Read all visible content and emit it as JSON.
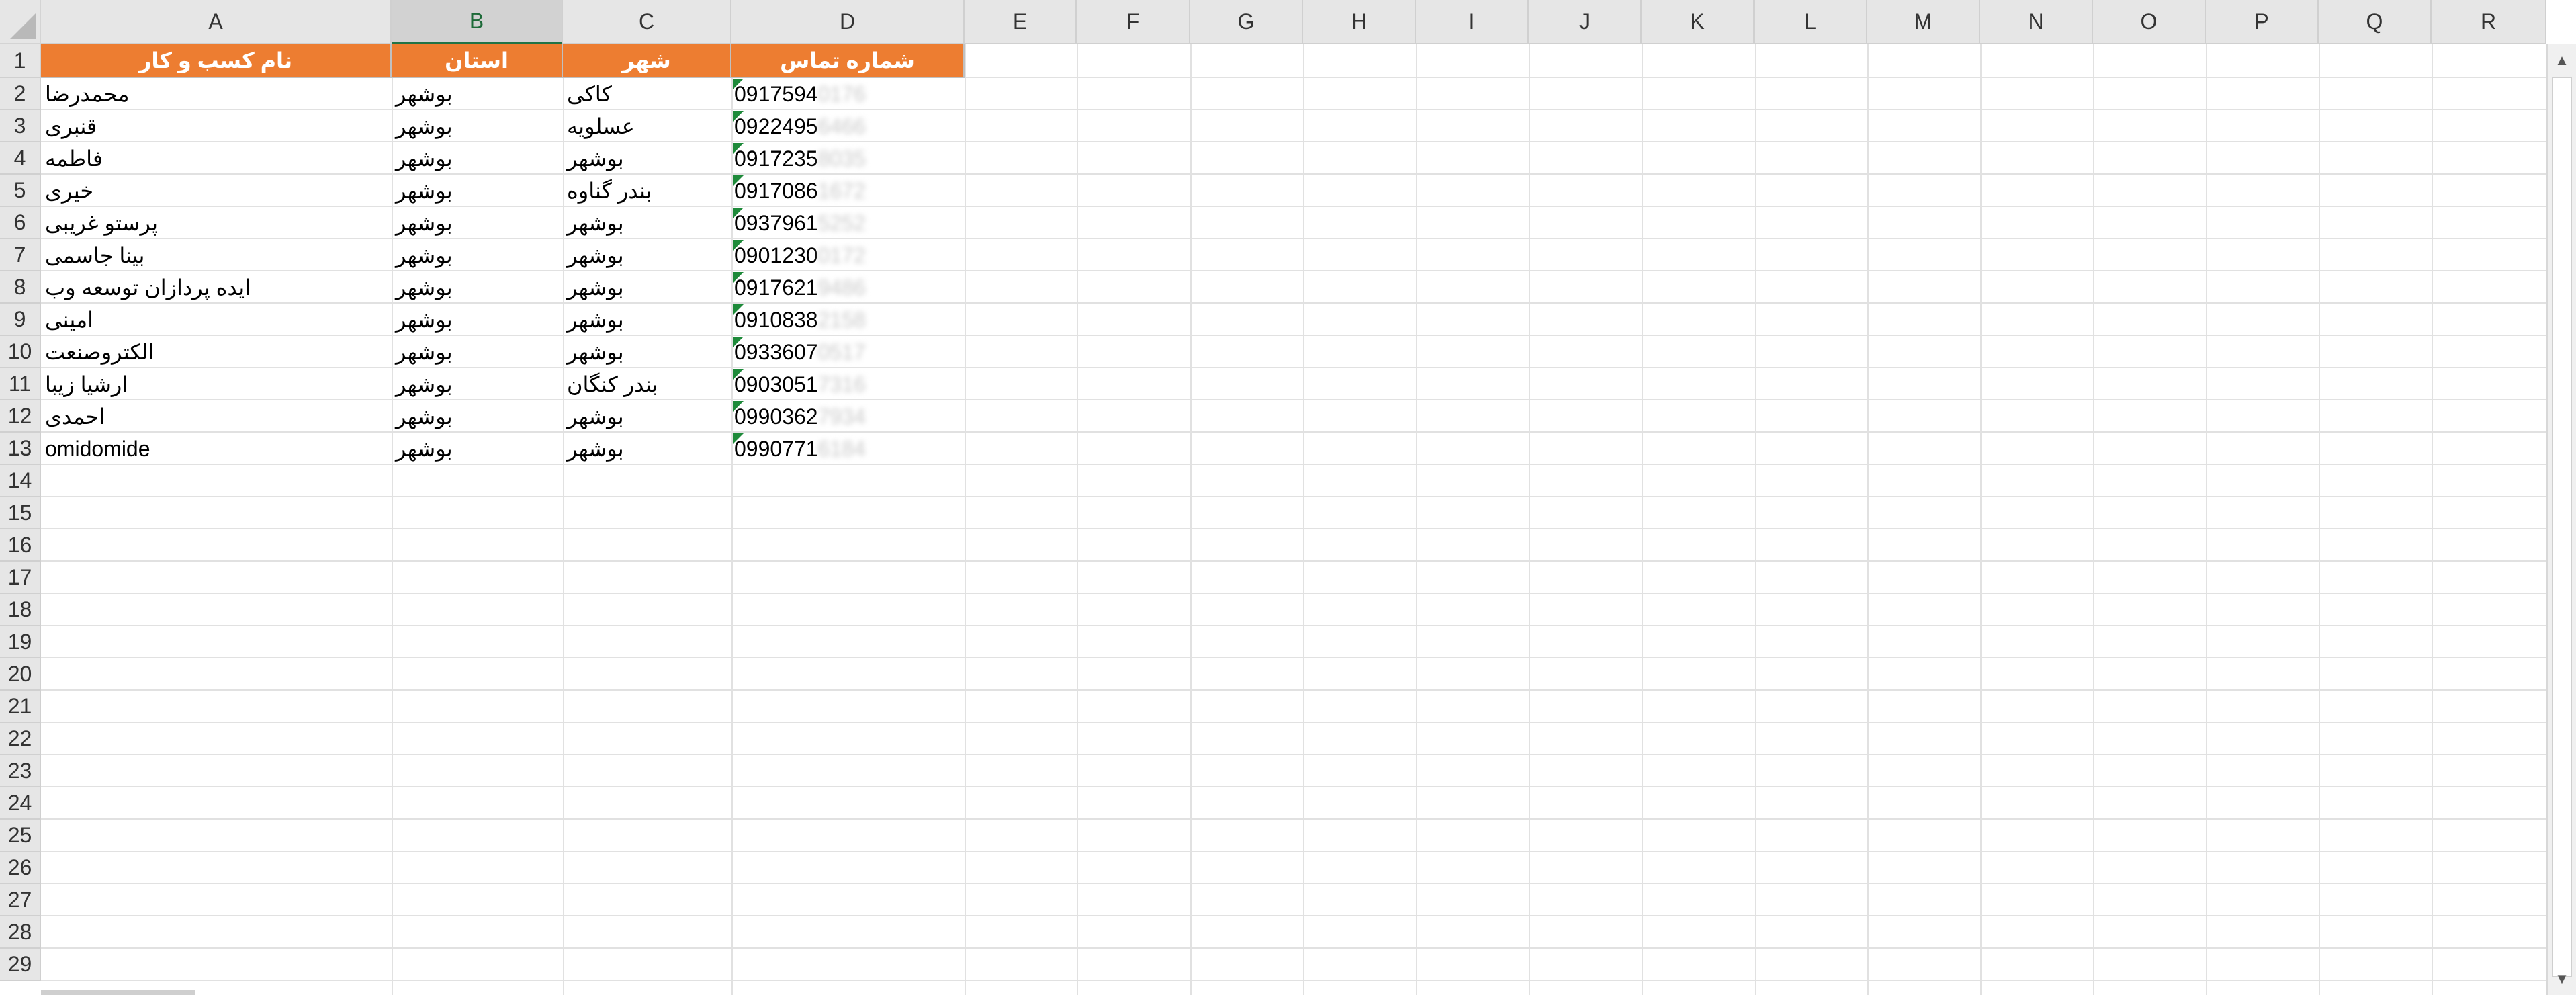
{
  "columns": [
    "A",
    "B",
    "C",
    "D",
    "E",
    "F",
    "G",
    "H",
    "I",
    "J",
    "K",
    "L",
    "M",
    "N",
    "O",
    "P",
    "Q",
    "R"
  ],
  "selected_column": "B",
  "row_numbers": [
    "1",
    "2",
    "3",
    "4",
    "5",
    "6",
    "7",
    "8",
    "9",
    "10",
    "11",
    "12",
    "13",
    "14",
    "15",
    "16",
    "17",
    "18",
    "19",
    "20",
    "21",
    "22",
    "23",
    "24",
    "25",
    "26",
    "27",
    "28",
    "29"
  ],
  "header_row": {
    "business_name": "نام کسب و کار",
    "province": "استان",
    "city": "شهر",
    "phone": "شماره تماس"
  },
  "rows": [
    {
      "name": "محمدرضا",
      "province": "بوشهر",
      "city": "کاکی",
      "phone": "0917594",
      "phone_hidden": "0176"
    },
    {
      "name": "قنبری",
      "province": "بوشهر",
      "city": "عسلویه",
      "phone": "0922495",
      "phone_hidden": "6466"
    },
    {
      "name": "فاطمه",
      "province": "بوشهر",
      "city": "بوشهر",
      "phone": "0917235",
      "phone_hidden": "8035"
    },
    {
      "name": "خیری",
      "province": "بوشهر",
      "city": "بندر گناوه",
      "phone": "0917086",
      "phone_hidden": "1672"
    },
    {
      "name": "پرستو غریبی",
      "province": "بوشهر",
      "city": "بوشهر",
      "phone": "0937961",
      "phone_hidden": "5252"
    },
    {
      "name": "بینا جاسمی",
      "province": "بوشهر",
      "city": "بوشهر",
      "phone": "0901230",
      "phone_hidden": "0172"
    },
    {
      "name": "ایده پردازان توسعه وب",
      "province": "بوشهر",
      "city": "بوشهر",
      "phone": "0917621",
      "phone_hidden": "9486"
    },
    {
      "name": "امینی",
      "province": "بوشهر",
      "city": "بوشهر",
      "phone": "0910838",
      "phone_hidden": "2158"
    },
    {
      "name": "الکتروصنعت",
      "province": "بوشهر",
      "city": "بوشهر",
      "phone": "0933607",
      "phone_hidden": "0517"
    },
    {
      "name": "ارشیا زیبا",
      "province": "بوشهر",
      "city": "بندر کنگان",
      "phone": "0903051",
      "phone_hidden": "7316"
    },
    {
      "name": "احمدی",
      "province": "بوشهر",
      "city": "بوشهر",
      "phone": "0990362",
      "phone_hidden": "7934"
    },
    {
      "name": "omidomide",
      "province": "بوشهر",
      "city": "بوشهر",
      "phone": "0990771",
      "phone_hidden": "6184"
    }
  ],
  "colors": {
    "header_fill": "#ed7d31",
    "header_text": "#ffffff",
    "number_as_text_marker": "#1e8a3a",
    "selected_column_accent": "#217346"
  },
  "icons": {
    "select_all": "triangle-corner",
    "scroll_up": "caret-up",
    "scroll_down": "caret-down"
  }
}
